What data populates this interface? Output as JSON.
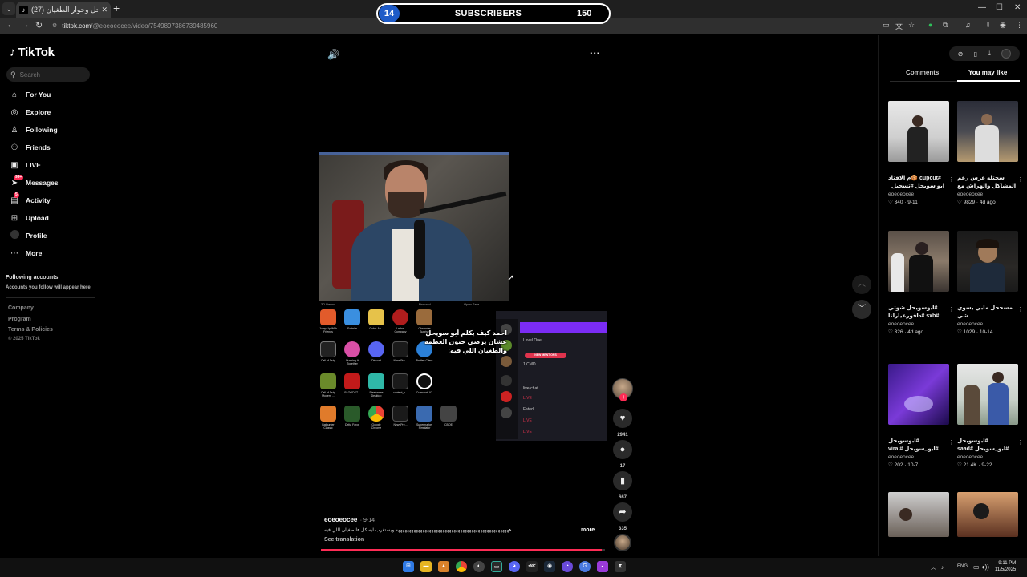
{
  "browser": {
    "tab_title": "أبو سويحل وحوار الطغيان (27)",
    "url_domain": "tiktok.com",
    "url_path": "/@eoeoeocee/video/7549897386739485960"
  },
  "overlay_widget": {
    "left_count": "14",
    "label": "SUBSCRIBERS",
    "right_count": "150"
  },
  "sidebar": {
    "logo": "TikTok",
    "search_placeholder": "Search",
    "items": [
      {
        "label": "For You",
        "icon": "home-icon"
      },
      {
        "label": "Explore",
        "icon": "compass-icon"
      },
      {
        "label": "Following",
        "icon": "person-icon"
      },
      {
        "label": "Friends",
        "icon": "people-icon"
      },
      {
        "label": "LIVE",
        "icon": "live-icon"
      },
      {
        "label": "Messages",
        "icon": "send-icon",
        "badge": "99+"
      },
      {
        "label": "Activity",
        "icon": "inbox-icon",
        "badge": "5"
      },
      {
        "label": "Upload",
        "icon": "plus-square-icon"
      },
      {
        "label": "Profile",
        "icon": "avatar-icon"
      },
      {
        "label": "More",
        "icon": "dots-icon"
      }
    ],
    "following_heading": "Following accounts",
    "following_sub": "Accounts you follow will appear here",
    "footer_links": [
      "Company",
      "Program",
      "Terms & Policies"
    ],
    "copyright": "© 2025 TikTok"
  },
  "video": {
    "overlay_text": "احمد كيف يكلم أبو سويحل عشان يرضي جنون العظمة والطغيان اللي فيه:",
    "cam_labels": [
      "3D Demo",
      "Protocol",
      "Open Seta"
    ],
    "desktop_icons": [
      "Jump Up With Friends",
      "Fortnite",
      "Gulch-Ap...",
      "Lethal Company",
      "Character Sunrise",
      "Call of Duty",
      "Pushing It Together",
      "Discord",
      "NewsPre...",
      "Battlen Client",
      "Call of Duty Modern ...",
      "BLOODST...",
      "Steelseries Desktop",
      "content_s...",
      "Crosshair V2",
      "Bathunter Classic",
      "Delta Force",
      "Google Chrome",
      "NewsPre...",
      "Supermarket Simulator",
      "CBOE"
    ],
    "panel": {
      "level": "Level One",
      "mention": "NEW MENTIONS",
      "cmd": "1 CMD",
      "live_chat": "live-chat",
      "live_tag": "LIVE",
      "fated": "Fated"
    }
  },
  "actions": {
    "likes": "2941",
    "comments": "17",
    "saves": "667",
    "shares": "335"
  },
  "post": {
    "author": "eoeoeocee",
    "date": "9-14",
    "description": "هههههههههههههههههههههههههههههههههههههههههههههههههههه ويستغرب ليه كل هالطغيان اللي فيه",
    "more": "more",
    "see_translation": "See translation",
    "progress": 0.99
  },
  "right_panel": {
    "tabs": [
      "Comments",
      "You may like"
    ],
    "cards": [
      {
        "title": "#cupcut 🍪م الاقتاد ابو سويحل #تسجيل_",
        "author": "eoeoeocee",
        "likes": "340",
        "date": "9-11"
      },
      {
        "title": "سحتله غرس رعم المشاكل والهراش مع عشرين منظم",
        "author": "eoeoeocee",
        "likes": "9829",
        "date": "4d ago"
      },
      {
        "title": "#ابوسويحل شوتي #sxb #دافورعيارلنا",
        "author": "eoeoeocee",
        "likes": "326",
        "date": "4d ago"
      },
      {
        "title": "مسحجل مابي يسوي شي ههههههههههههههههه",
        "author": "eoeoeocee",
        "likes": "1029",
        "date": "10-14"
      },
      {
        "title": "#ابوسويحل #ابو_سويحل #viral #دفور",
        "author": "eoeoeocee",
        "likes": "202",
        "date": "10-7"
      },
      {
        "title": "#ابوسويحل #ابو_سويحل #saad #دفور",
        "author": "eoeoeocee",
        "likes": "21.4K",
        "date": "9-22"
      }
    ]
  },
  "taskbar": {
    "lang": "ENG",
    "time": "9:11 PM",
    "date": "11/5/2025"
  }
}
